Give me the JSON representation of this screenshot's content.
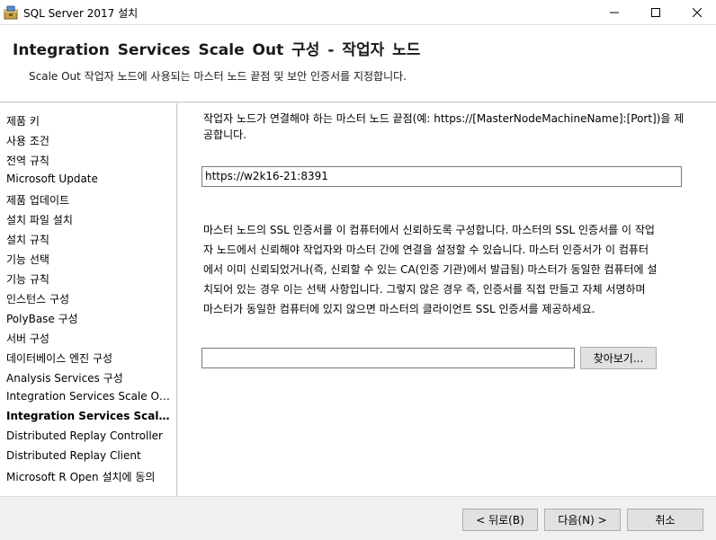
{
  "window": {
    "title": "SQL Server 2017 설치"
  },
  "header": {
    "title": "Integration Services Scale Out 구성 - 작업자 노드",
    "subtitle": "Scale Out 작업자 노드에 사용되는 마스터 노드 끝점 및 보안 인증서를 지정합니다."
  },
  "sidebar": {
    "items": [
      {
        "label": "제품 키"
      },
      {
        "label": "사용 조건"
      },
      {
        "label": "전역 규칙"
      },
      {
        "label": "Microsoft Update"
      },
      {
        "label": "제품 업데이트"
      },
      {
        "label": "설치 파일 설치"
      },
      {
        "label": "설치 규칙"
      },
      {
        "label": "기능 선택"
      },
      {
        "label": "기능 규칙"
      },
      {
        "label": "인스턴스 구성"
      },
      {
        "label": "PolyBase 구성"
      },
      {
        "label": "서버 구성"
      },
      {
        "label": "데이터베이스 엔진 구성"
      },
      {
        "label": "Analysis Services 구성"
      },
      {
        "label": "Integration Services Scale Out ..."
      },
      {
        "label": "Integration Services Scale O..."
      },
      {
        "label": "Distributed Replay Controller"
      },
      {
        "label": "Distributed Replay Client"
      },
      {
        "label": "Microsoft R Open 설치에 동의"
      }
    ]
  },
  "main": {
    "endpoint_label_line1": "작업자 노드가 연결해야 하는 마스터 노드 끝점(예: https://[MasterNodeMachineName]:[Port])을 제",
    "endpoint_label_line2": "공합니다.",
    "endpoint_value": "https://w2k16-21:8391",
    "cert_desc_lines": [
      "마스터 노드의 SSL 인증서를 이 컴퓨터에서 신뢰하도록 구성합니다. 마스터의 SSL 인증서를 이 작업",
      "자 노드에서 신뢰해야 작업자와 마스터 간에 연결을 설정할 수 있습니다. 마스터 인증서가 이 컴퓨터",
      "에서 이미 신뢰되었거나(즉, 신뢰할 수 있는 CA(인증 기관)에서 발급됨) 마스터가 동일한 컴퓨터에 설",
      "치되어 있는 경우 이는 선택 사항입니다. 그렇지 않은 경우 즉, 인증서를 직접 만들고 자체 서명하며",
      "마스터가 동일한 컴퓨터에 있지 않으면 마스터의 클라이언트 SSL 인증서를 제공하세요."
    ],
    "cert_path_value": "",
    "browse_label": "찾아보기..."
  },
  "footer": {
    "back_label": "< 뒤로(B)",
    "next_label": "다음(N) >",
    "cancel_label": "취소"
  }
}
